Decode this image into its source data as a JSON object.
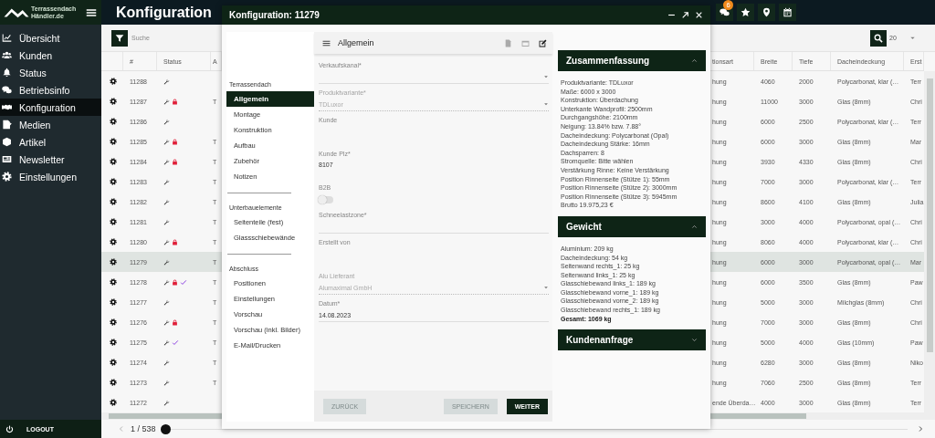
{
  "logo": {
    "line_1": "Terrassendach",
    "line_2": "Händler.de"
  },
  "header": {
    "title": "Konfiguration",
    "notification_count": "6"
  },
  "sidebar": {
    "items": [
      {
        "label": "Übersicht",
        "selected": false
      },
      {
        "label": "Kunden",
        "selected": false
      },
      {
        "label": "Status",
        "selected": false
      },
      {
        "label": "Betriebsinfo",
        "selected": false
      },
      {
        "label": "Konfiguration",
        "selected": true
      },
      {
        "label": "Medien",
        "selected": false
      },
      {
        "label": "Artikel",
        "selected": false
      },
      {
        "label": "Newsletter",
        "selected": false
      },
      {
        "label": "Einstellungen",
        "selected": false
      }
    ],
    "logout": "LOGOUT"
  },
  "toolbar": {
    "search_placeholder": "Suche",
    "page_size": "20"
  },
  "table": {
    "columns": [
      "#",
      "Status",
      "A",
      "tionsart",
      "Breite",
      "Tiefe",
      "Dacheindeckung",
      "Erst"
    ],
    "rows": [
      {
        "id": "11288",
        "locked": false,
        "done": false,
        "selected": false,
        "art": "hung",
        "breite": "4060",
        "tiefe": "2000",
        "dach": "Polycarbonat, klar (…",
        "erste": "Terr"
      },
      {
        "id": "11287",
        "locked": true,
        "done": false,
        "selected": false,
        "a": "T",
        "art": "hung",
        "breite": "11000",
        "tiefe": "3000",
        "dach": "Glas (8mm)",
        "erste": "Chri"
      },
      {
        "id": "11286",
        "locked": false,
        "done": false,
        "selected": false,
        "art": "hung",
        "breite": "6000",
        "tiefe": "2500",
        "dach": "Polycarbonat, klar (…",
        "erste": "Terr"
      },
      {
        "id": "11285",
        "locked": true,
        "done": false,
        "selected": false,
        "a": "T",
        "art": "hung",
        "breite": "6000",
        "tiefe": "3000",
        "dach": "Glas (8mm)",
        "erste": "Mar"
      },
      {
        "id": "11284",
        "locked": true,
        "done": false,
        "selected": false,
        "a": "T",
        "art": "hung",
        "breite": "3930",
        "tiefe": "4330",
        "dach": "Glas (8mm)",
        "erste": "Chri"
      },
      {
        "id": "11283",
        "locked": false,
        "done": false,
        "selected": false,
        "a": "T",
        "art": "hung",
        "breite": "7000",
        "tiefe": "3000",
        "dach": "Polycarbonat, klar (…",
        "erste": "Terr"
      },
      {
        "id": "11282",
        "locked": false,
        "done": false,
        "selected": false,
        "a": "T",
        "art": "hung",
        "breite": "8600",
        "tiefe": "4100",
        "dach": "Glas (8mm)",
        "erste": "Julia"
      },
      {
        "id": "11281",
        "locked": false,
        "done": false,
        "selected": false,
        "a": "T",
        "art": "hung",
        "breite": "3000",
        "tiefe": "4000",
        "dach": "Polycarbonat, opal (…",
        "erste": "Chri"
      },
      {
        "id": "11280",
        "locked": true,
        "done": false,
        "selected": false,
        "a": "T",
        "art": "hung",
        "breite": "8060",
        "tiefe": "4000",
        "dach": "Polycarbonat, klar (…",
        "erste": "Chri"
      },
      {
        "id": "11279",
        "locked": false,
        "done": false,
        "selected": true,
        "a": "T",
        "art": "hung",
        "breite": "6000",
        "tiefe": "3000",
        "dach": "Polycarbonat, opal (…",
        "erste": "Mar"
      },
      {
        "id": "11278",
        "locked": true,
        "done": true,
        "selected": false,
        "a": "T",
        "art": "hung",
        "breite": "6000",
        "tiefe": "3500",
        "dach": "Glas (8mm)",
        "erste": "Paw"
      },
      {
        "id": "11277",
        "locked": false,
        "done": false,
        "selected": false,
        "a": "T",
        "art": "hung",
        "breite": "5000",
        "tiefe": "3000",
        "dach": "Milchglas (8mm)",
        "erste": "Chri"
      },
      {
        "id": "11276",
        "locked": true,
        "done": false,
        "selected": false,
        "a": "T",
        "art": "hung",
        "breite": "7000",
        "tiefe": "3000",
        "dach": "Glas (8mm)",
        "erste": "Chri"
      },
      {
        "id": "11275",
        "locked": false,
        "done": true,
        "selected": false,
        "a": "T",
        "art": "hung",
        "breite": "5000",
        "tiefe": "4000",
        "dach": "Glas (10mm)",
        "erste": "Paw"
      },
      {
        "id": "11274",
        "locked": false,
        "done": false,
        "selected": false,
        "a": "T",
        "art": "hung",
        "breite": "6280",
        "tiefe": "3000",
        "dach": "Glas (8mm)",
        "erste": "Niko"
      },
      {
        "id": "11273",
        "locked": false,
        "done": false,
        "selected": false,
        "a": "T",
        "art": "hung",
        "breite": "7060",
        "tiefe": "2500",
        "dach": "Glas (8mm)",
        "erste": "Terr"
      },
      {
        "id": "11272",
        "locked": false,
        "done": false,
        "selected": false,
        "art": "ende Überda…",
        "breite": "4000",
        "tiefe": "3000",
        "dach": "Glas (8mm)",
        "erste": "Terr"
      }
    ]
  },
  "pager": {
    "page": "1 / 538",
    "level": 0
  },
  "dialog": {
    "title": "Konfiguration: 11279",
    "nav": [
      {
        "title": "Terrassendach",
        "items": [
          {
            "label": "Allgemein",
            "selected": true
          },
          {
            "label": "Montage",
            "selected": false
          },
          {
            "label": "Konstruktion",
            "selected": false
          },
          {
            "label": "Aufbau",
            "selected": false
          },
          {
            "label": "Zubehör",
            "selected": false
          },
          {
            "label": "Notizen",
            "selected": false
          }
        ]
      },
      {
        "title": "Unterbauelemente",
        "items": [
          {
            "label": "Seitenteile (fest)",
            "selected": false
          },
          {
            "label": "Glassschiebewände",
            "selected": false
          }
        ]
      },
      {
        "title": "Abschluss",
        "items": [
          {
            "label": "Positionen",
            "selected": false
          },
          {
            "label": "Einstellungen",
            "selected": false
          },
          {
            "label": "Vorschau",
            "selected": false
          },
          {
            "label": "Vorschau (inkl. Bilder)",
            "selected": false
          },
          {
            "label": "E-Mail/Drucken",
            "selected": false
          }
        ]
      }
    ],
    "form": {
      "title": "Allgemein",
      "fields": [
        {
          "kind": "select",
          "label": "Verkaufskanal*",
          "disabled": false
        },
        {
          "kind": "select",
          "label": "Produktvariante*",
          "value": "TDLuxor",
          "disabled": true
        },
        {
          "kind": "plain",
          "label": "Kunde",
          "disabled": false
        },
        {
          "kind": "plain",
          "label": "Kunde Plz*",
          "value": "8107",
          "disabled": false
        },
        {
          "kind": "toggle",
          "label": "B2B",
          "on": false,
          "disabled": false
        },
        {
          "kind": "text",
          "label": "Schneelastzone*",
          "disabled": false
        },
        {
          "kind": "plain",
          "label": "Erstellt von",
          "disabled": false
        },
        {
          "kind": "select",
          "label": "Alu Lieferant",
          "value": "Alumaximal GmbH",
          "disabled": true
        },
        {
          "kind": "text",
          "label": "Datum*",
          "value": "14.08.2023",
          "disabled": false
        }
      ],
      "buttons": [
        {
          "label": "ZURÜCK",
          "disabled": true
        },
        {
          "label": "SPEICHERN",
          "disabled": true
        },
        {
          "label": "WEITER",
          "disabled": false
        }
      ]
    },
    "panels": [
      {
        "title": "Zusammenfassung",
        "expanded": true,
        "lines": [
          "Produktvariante: TDLuxor",
          "Maße: 6000 x 3000",
          "Konstruktion: Überdachung",
          "Unterkante Wandprofil: 2500mm",
          "Durchgangshöhe: 2100mm",
          "Neigung: 13.84% bzw. 7.88°",
          "Dacheindeckung: Polycarbonat (Opal)",
          "Dacheindeckung Stärke: 16mm",
          "Dachsparren: 8",
          "Stromquelle: Bitte wählen",
          "Verstärkung Rinne: Keine Verstärkung",
          "Position Rinnenseite (Stütze 1): 55mm",
          "Position Rinnenseite (Stütze 2): 3000mm",
          "Position Rinnenseite (Stütze 3): 5945mm",
          "Brutto 19.975,23 €"
        ]
      },
      {
        "title": "Gewicht",
        "expanded": true,
        "lines": [
          "Aluminium: 209 kg",
          "Dacheindeckung: 54 kg",
          "Seitenwand rechts_1: 25 kg",
          "Seitenwand links_1: 25 kg",
          "Glasschiebewand links_1: 189 kg",
          "Glasschiebewand vorne_1: 189 kg",
          "Glasschiebewand vorne_2: 189 kg",
          "Glasschiebewand rechts_1: 189 kg"
        ],
        "total": "Gesamt: 1069 kg"
      },
      {
        "title": "Kundenanfrage",
        "expanded": false
      }
    ]
  }
}
